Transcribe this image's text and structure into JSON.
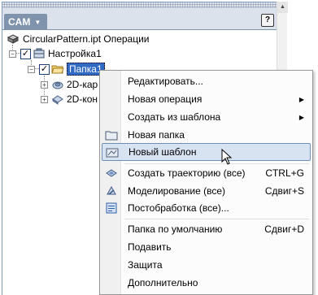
{
  "panel": {
    "tab_label": "CAM",
    "help_label": "?"
  },
  "tree": {
    "root_label": "CircularPattern.ipt Операции",
    "setup_label": "Настройка1",
    "folder_label": "Папка1",
    "op1_label": "2D-кар",
    "op2_label": "2D-кон"
  },
  "menu": {
    "items": [
      {
        "label": "Редактировать...",
        "shortcut": "",
        "submenu": false
      },
      {
        "label": "Новая операция",
        "shortcut": "",
        "submenu": true
      },
      {
        "label": "Создать из шаблона",
        "shortcut": "",
        "submenu": true
      },
      {
        "label": "Новая папка",
        "shortcut": "",
        "submenu": false
      },
      {
        "label": "Новый шаблон",
        "shortcut": "",
        "submenu": false
      },
      {
        "label": "Создать траекторию (все)",
        "shortcut": "CTRL+G",
        "submenu": false
      },
      {
        "label": "Моделирование (все)",
        "shortcut": "Сдвиг+S",
        "submenu": false
      },
      {
        "label": "Постобработка (все)...",
        "shortcut": "",
        "submenu": false
      },
      {
        "label": "Папка по умолчанию",
        "shortcut": "Сдвиг+D",
        "submenu": false
      },
      {
        "label": "Подавить",
        "shortcut": "",
        "submenu": false
      },
      {
        "label": "Защита",
        "shortcut": "",
        "submenu": false
      },
      {
        "label": "Дополнительно",
        "shortcut": "",
        "submenu": false
      }
    ],
    "submenu_arrow": "▶"
  },
  "icons": {
    "part": "part-icon",
    "setup": "setup-icon",
    "folder": "folder-icon",
    "operation": "operation-icon"
  },
  "colors": {
    "selection": "#316ac5",
    "header": "#7f93ad",
    "menu_highlight": "#d8e3f2"
  }
}
